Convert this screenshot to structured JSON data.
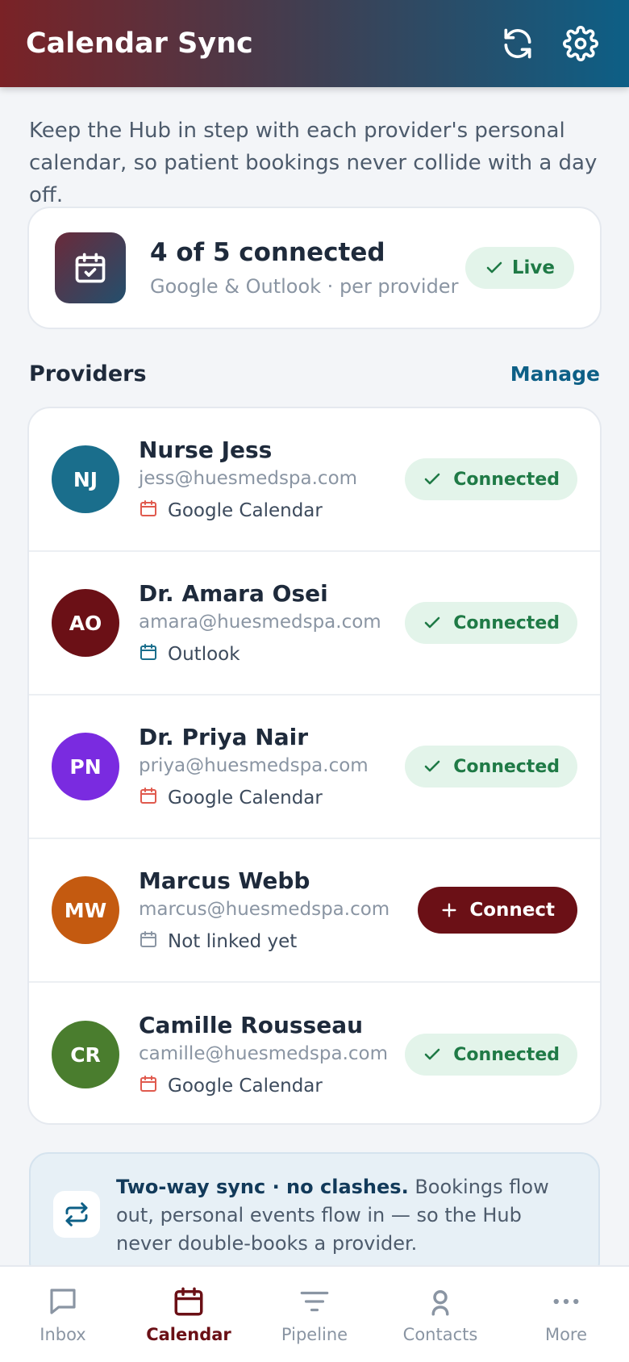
{
  "header": {
    "title": "Calendar Sync",
    "refresh_icon": "refresh-icon",
    "settings_icon": "gear-icon"
  },
  "intro": "Keep the Hub in step with each provider's personal calendar, so patient bookings never collide with a day off.",
  "summary": {
    "title": "4 of 5 connected",
    "subtitle": "Google & Outlook · per provider",
    "badge": "Live",
    "icon": "calendar-check-icon"
  },
  "providers_section": {
    "title": "Providers",
    "action": "Manage"
  },
  "providers": [
    {
      "initials": "NJ",
      "name": "Nurse Jess",
      "email": "jess@huesmedspa.com",
      "calendar": "Google Calendar",
      "status": "Connected",
      "avatar_color": "#1a6e8c",
      "cal_color": "#e05a4e"
    },
    {
      "initials": "AO",
      "name": "Dr. Amara Osei",
      "email": "amara@huesmedspa.com",
      "calendar": "Outlook",
      "status": "Connected",
      "avatar_color": "#6b1016",
      "cal_color": "#1a6e8c"
    },
    {
      "initials": "PN",
      "name": "Dr. Priya Nair",
      "email": "priya@huesmedspa.com",
      "calendar": "Google Calendar",
      "status": "Connected",
      "avatar_color": "#7a2be0",
      "cal_color": "#e05a4e"
    },
    {
      "initials": "MW",
      "name": "Marcus Webb",
      "email": "marcus@huesmedspa.com",
      "calendar": "Not linked yet",
      "status": "Connect",
      "avatar_color": "#c45a10",
      "cal_color": "#8a95a3"
    },
    {
      "initials": "CR",
      "name": "Camille Rousseau",
      "email": "camille@huesmedspa.com",
      "calendar": "Google Calendar",
      "status": "Connected",
      "avatar_color": "#4a7d2e",
      "cal_color": "#e05a4e"
    }
  ],
  "info": {
    "bold": "Two-way sync · no clashes.",
    "text": " Bookings flow out, personal events flow in — so the Hub never double-books a provider.",
    "icon": "sync-arrows-icon"
  },
  "nav": [
    {
      "label": "Inbox",
      "icon": "chat-icon",
      "active": false
    },
    {
      "label": "Calendar",
      "icon": "calendar-icon",
      "active": true
    },
    {
      "label": "Pipeline",
      "icon": "filter-icon",
      "active": false
    },
    {
      "label": "Contacts",
      "icon": "person-icon",
      "active": false
    },
    {
      "label": "More",
      "icon": "more-icon",
      "active": false
    }
  ]
}
